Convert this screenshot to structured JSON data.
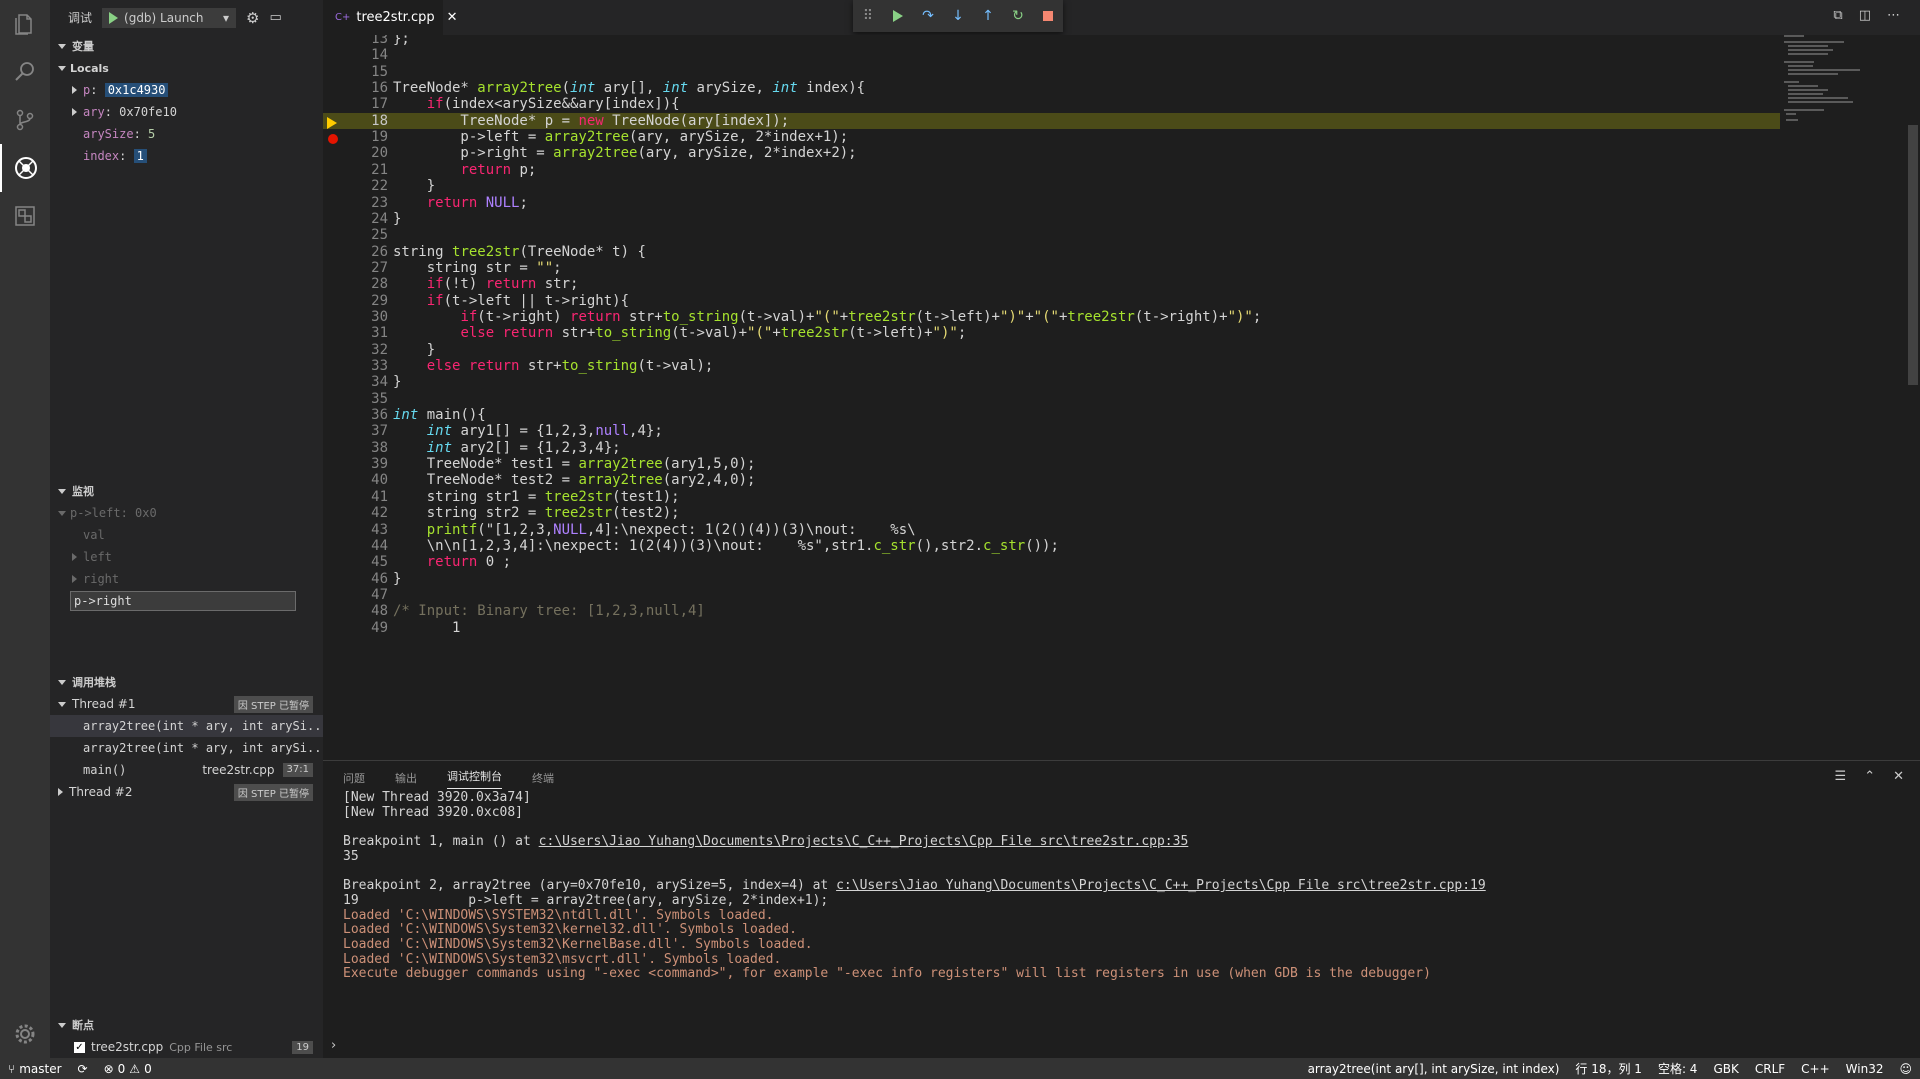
{
  "activity": {
    "icons": [
      "files-icon",
      "search-icon",
      "source-control-icon",
      "debug-icon",
      "extensions-icon",
      "settings-gear-icon"
    ]
  },
  "debug": {
    "title": "调试",
    "config": "(gdb) Launch"
  },
  "variables": {
    "header": "变量",
    "locals_header": "Locals",
    "items": [
      {
        "name": "p",
        "value": "0x1c4930"
      },
      {
        "name": "ary",
        "value": "0x70fe10"
      },
      {
        "name": "arySize",
        "value": "5"
      },
      {
        "name": "index",
        "value": "1"
      }
    ]
  },
  "watch": {
    "header": "监视",
    "items": [
      "p->left: 0x0",
      "val",
      "left",
      "right"
    ],
    "input_value": "p->right"
  },
  "callstack": {
    "header": "调用堆栈",
    "thread1": "Thread #1",
    "thread1_badge": "因 STEP 已暂停",
    "frames": [
      {
        "name": "array2tree(int * ary, int arySi...",
        "file": "",
        "pos": ""
      },
      {
        "name": "array2tree(int * ary, int arySi...",
        "file": "",
        "pos": ""
      },
      {
        "name": "main()",
        "file": "tree2str.cpp",
        "pos": "37:1"
      }
    ],
    "thread2": "Thread #2",
    "thread2_badge": "因 STEP 已暂停"
  },
  "breakpoints": {
    "header": "断点",
    "file": "tree2str.cpp",
    "folder": "Cpp File src",
    "line": "19"
  },
  "editor": {
    "tab": "tree2str.cpp",
    "current_line": 18,
    "breakpoint_line": 19,
    "lines": [
      {
        "n": "13",
        "code": "};"
      },
      {
        "n": "14",
        "code": ""
      },
      {
        "n": "15",
        "code": ""
      },
      {
        "n": "16",
        "code": "TreeNode* array2tree(int ary[], int arySize, int index){"
      },
      {
        "n": "17",
        "code": "    if(index<arySize&&ary[index]){"
      },
      {
        "n": "18",
        "code": "        TreeNode* p = new TreeNode(ary[index]);"
      },
      {
        "n": "19",
        "code": "        p->left = array2tree(ary, arySize, 2*index+1);"
      },
      {
        "n": "20",
        "code": "        p->right = array2tree(ary, arySize, 2*index+2);"
      },
      {
        "n": "21",
        "code": "        return p;"
      },
      {
        "n": "22",
        "code": "    }"
      },
      {
        "n": "23",
        "code": "    return NULL;"
      },
      {
        "n": "24",
        "code": "}"
      },
      {
        "n": "25",
        "code": ""
      },
      {
        "n": "26",
        "code": "string tree2str(TreeNode* t) {"
      },
      {
        "n": "27",
        "code": "    string str = \"\";"
      },
      {
        "n": "28",
        "code": "    if(!t) return str;"
      },
      {
        "n": "29",
        "code": "    if(t->left || t->right){"
      },
      {
        "n": "30",
        "code": "        if(t->right) return str+to_string(t->val)+\"(\"+tree2str(t->left)+\")\"+\"(\"+tree2str(t->right)+\")\";"
      },
      {
        "n": "31",
        "code": "        else return str+to_string(t->val)+\"(\"+tree2str(t->left)+\")\";"
      },
      {
        "n": "32",
        "code": "    }"
      },
      {
        "n": "33",
        "code": "    else return str+to_string(t->val);"
      },
      {
        "n": "34",
        "code": "}"
      },
      {
        "n": "35",
        "code": ""
      },
      {
        "n": "36",
        "code": "int main(){"
      },
      {
        "n": "37",
        "code": "    int ary1[] = {1,2,3,null,4};"
      },
      {
        "n": "38",
        "code": "    int ary2[] = {1,2,3,4};"
      },
      {
        "n": "39",
        "code": "    TreeNode* test1 = array2tree(ary1,5,0);"
      },
      {
        "n": "40",
        "code": "    TreeNode* test2 = array2tree(ary2,4,0);"
      },
      {
        "n": "41",
        "code": "    string str1 = tree2str(test1);"
      },
      {
        "n": "42",
        "code": "    string str2 = tree2str(test2);"
      },
      {
        "n": "43",
        "code": "    printf(\"[1,2,3,NULL,4]:\\nexpect: 1(2()(4))(3)\\nout:    %s\\"
      },
      {
        "n": "44",
        "code": "    \\n\\n[1,2,3,4]:\\nexpect: 1(2(4))(3)\\nout:    %s\",str1.c_str(),str2.c_str());"
      },
      {
        "n": "45",
        "code": "    return 0 ;"
      },
      {
        "n": "46",
        "code": "}"
      },
      {
        "n": "47",
        "code": ""
      },
      {
        "n": "48",
        "code": "/* Input: Binary tree: [1,2,3,null,4]"
      },
      {
        "n": "49",
        "code": "       1"
      }
    ]
  },
  "panel": {
    "tabs": [
      "问题",
      "输出",
      "调试控制台",
      "终端"
    ],
    "active_tab": 2,
    "console": [
      {
        "text": "[New Thread 3920.0x3a74]",
        "kind": "normal"
      },
      {
        "text": "[New Thread 3920.0xc08]",
        "kind": "normal"
      },
      {
        "text": "",
        "kind": "normal"
      },
      {
        "text": "Breakpoint 1, main () at ",
        "link": "c:\\Users\\Jiao Yuhang\\Documents\\Projects\\C_C++_Projects\\Cpp File src\\tree2str.cpp:35",
        "kind": "normal"
      },
      {
        "text": "35",
        "kind": "normal"
      },
      {
        "text": "",
        "kind": "normal"
      },
      {
        "text": "Breakpoint 2, array2tree (ary=0x70fe10, arySize=5, index=4) at ",
        "link": "c:\\Users\\Jiao Yuhang\\Documents\\Projects\\C_C++_Projects\\Cpp File src\\tree2str.cpp:19",
        "kind": "normal"
      },
      {
        "text": "19              p->left = array2tree(ary, arySize, 2*index+1);",
        "kind": "normal"
      },
      {
        "text": "Loaded 'C:\\WINDOWS\\SYSTEM32\\ntdll.dll'. Symbols loaded.",
        "kind": "warn"
      },
      {
        "text": "Loaded 'C:\\WINDOWS\\System32\\kernel32.dll'. Symbols loaded.",
        "kind": "warn"
      },
      {
        "text": "Loaded 'C:\\WINDOWS\\System32\\KernelBase.dll'. Symbols loaded.",
        "kind": "warn"
      },
      {
        "text": "Loaded 'C:\\WINDOWS\\System32\\msvcrt.dll'. Symbols loaded.",
        "kind": "warn"
      },
      {
        "text": "Execute debugger commands using \"-exec <command>\", for example \"-exec info registers\" will list registers in use (when GDB is the debugger)",
        "kind": "warn"
      }
    ],
    "repl_prompt": "›"
  },
  "status": {
    "branch": "master",
    "errors": "0",
    "warnings": "0",
    "func": "array2tree(int ary[], int arySize, int index)",
    "position": "行 18，列 1",
    "spaces": "空格: 4",
    "encoding": "GBK",
    "eol": "CRLF",
    "language": "C++",
    "platform": "Win32"
  }
}
